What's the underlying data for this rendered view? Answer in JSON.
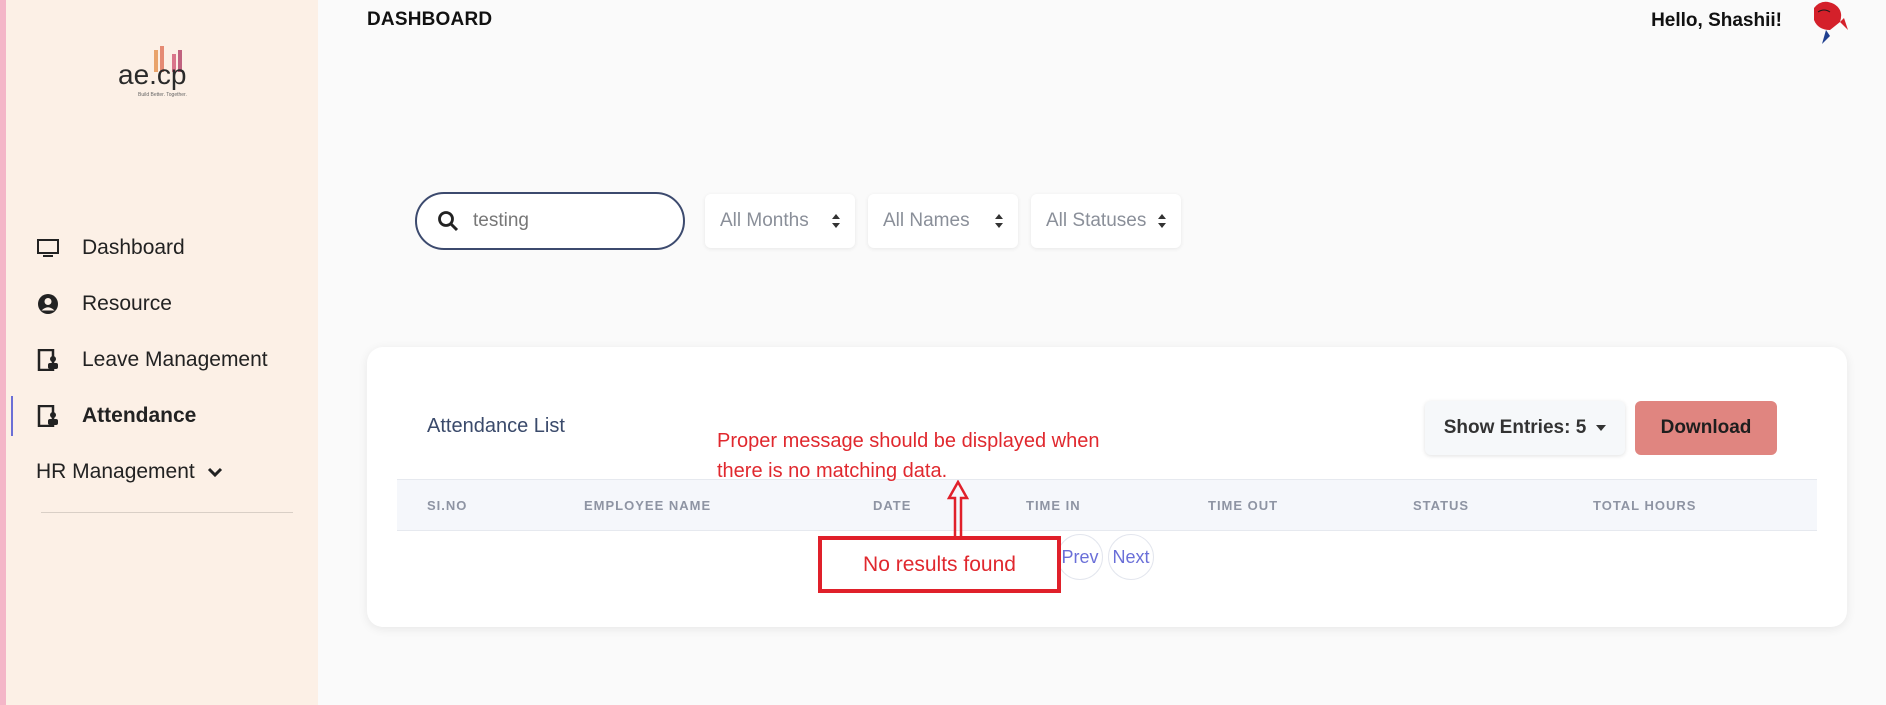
{
  "sidebar": {
    "items": [
      {
        "label": "Dashboard",
        "icon": "monitor-icon",
        "active": false
      },
      {
        "label": "Resource",
        "icon": "user-circle-icon",
        "active": false
      },
      {
        "label": "Leave Management",
        "icon": "clipboard-user-icon",
        "active": false
      },
      {
        "label": "Attendance",
        "icon": "clipboard-user-icon",
        "active": true
      },
      {
        "label": "HR Management",
        "icon": "chevron-down-icon",
        "active": false
      }
    ]
  },
  "header": {
    "title": "DASHBOARD",
    "greeting": "Hello, Shashii!"
  },
  "filters": {
    "search_value": "testing",
    "months": "All Months",
    "names": "All Names",
    "statuses": "All Statuses"
  },
  "card": {
    "title": "Attendance List",
    "show_entries": "Show Entries: 5",
    "download": "Download",
    "columns": [
      "SI.NO",
      "EMPLOYEE NAME",
      "DATE",
      "TIME IN",
      "TIME OUT",
      "STATUS",
      "TOTAL HOURS"
    ],
    "empty_message": "No results found",
    "prev": "Prev",
    "next": "Next"
  },
  "annotation": {
    "text": "Proper message should be displayed when\nthere is no matching data."
  },
  "colors": {
    "sidebar_bg": "#fcf0e6",
    "accent": "#6b6fd6",
    "download": "#e08580",
    "annotation": "#e0282e"
  }
}
